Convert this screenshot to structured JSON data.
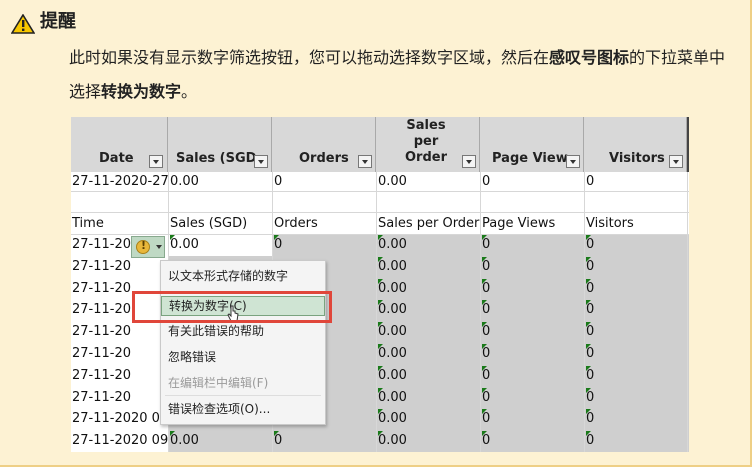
{
  "title": "提醒",
  "instruction": {
    "before": "此时如果没有显示数字筛选按钮，您可以拖动选择数字区域，然后在",
    "bold1": "感叹号图标",
    "middle": "的下拉菜单中选择",
    "bold2": "转换为数字",
    "end": "。"
  },
  "sheet": {
    "header": [
      "Date",
      "Sales (SGD",
      "Orders",
      "Sales per Order",
      "Page View",
      "Visitors"
    ],
    "row1": [
      "27-11-2020-27-",
      "0.00",
      "0",
      "0.00",
      "0",
      "0"
    ],
    "row2": [
      "Time",
      "Sales (SGD)",
      "Orders",
      "Sales per Order",
      "Page Views",
      "Visitors"
    ],
    "data_rows": [
      [
        "27-11-202",
        "0.00",
        "0",
        "0.00",
        "0",
        "0"
      ],
      [
        "27-11-202",
        "",
        "",
        "0.00",
        "0",
        "0"
      ],
      [
        "27-11-202",
        "",
        "",
        "0.00",
        "0",
        "0"
      ],
      [
        "27-11-202",
        "",
        "",
        "0.00",
        "0",
        "0"
      ],
      [
        "27-11-202",
        "",
        "",
        "0.00",
        "0",
        "0"
      ],
      [
        "27-11-202",
        "",
        "",
        "0.00",
        "0",
        "0"
      ],
      [
        "27-11-202",
        "",
        "",
        "0.00",
        "0",
        "0"
      ],
      [
        "27-11-202",
        "",
        "",
        "0.00",
        "0",
        "0"
      ],
      [
        "27-11-2020 00.",
        "",
        "",
        "0.00",
        "0",
        "0"
      ],
      [
        "27-11-2020 09:",
        "0.00",
        "0",
        "0.00",
        "0",
        "0"
      ]
    ]
  },
  "menu": {
    "items": [
      "以文本形式存储的数字",
      "转换为数字(C)",
      "有关此错误的帮助",
      "忽略错误",
      "在编辑栏中编辑(F)",
      "错误检查选项(O)..."
    ]
  },
  "colors": {
    "background": "#fdf2d3",
    "highlight": "#e0463a",
    "menu_hover": "#cfe4d3"
  },
  "icons": [
    "warning-icon",
    "error-indicator-icon",
    "dropdown-arrow-icon",
    "mouse-cursor-icon"
  ]
}
